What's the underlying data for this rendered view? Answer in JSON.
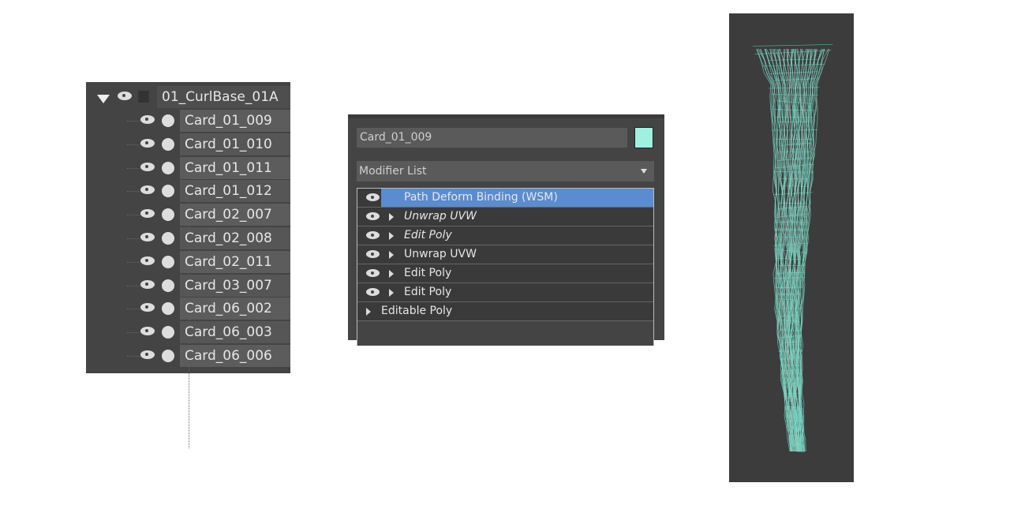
{
  "scene_explorer": {
    "root": {
      "name": "01_CurlBase_01A",
      "expanded": true
    },
    "children": [
      "Card_01_009",
      "Card_01_010",
      "Card_01_011",
      "Card_01_012",
      "Card_02_007",
      "Card_02_008",
      "Card_02_011",
      "Card_03_007",
      "Card_06_002",
      "Card_06_003",
      "Card_06_006"
    ]
  },
  "modify_panel": {
    "object_name": "Card_01_009",
    "object_color": "#9ef0e0",
    "modifier_list_label": "Modifier List",
    "stack": [
      {
        "label": "Path Deform Binding (WSM)",
        "selected": true,
        "italic": false,
        "eye": true,
        "expandable": false
      },
      {
        "label": "Unwrap UVW",
        "selected": false,
        "italic": true,
        "eye": true,
        "expandable": true
      },
      {
        "label": "Edit Poly",
        "selected": false,
        "italic": true,
        "eye": true,
        "expandable": true
      },
      {
        "label": "Unwrap UVW",
        "selected": false,
        "italic": false,
        "eye": true,
        "expandable": true
      },
      {
        "label": "Edit Poly",
        "selected": false,
        "italic": false,
        "eye": true,
        "expandable": true
      },
      {
        "label": "Edit Poly",
        "selected": false,
        "italic": false,
        "eye": true,
        "expandable": true
      },
      {
        "label": "Editable Poly",
        "selected": false,
        "italic": false,
        "eye": false,
        "expandable": true
      }
    ]
  },
  "viewport": {
    "wire_color": "#6fe0c8",
    "background": "#3c3c3c"
  }
}
